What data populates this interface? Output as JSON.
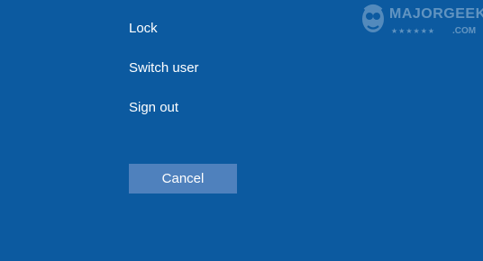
{
  "menu": {
    "items": [
      {
        "label": "Lock"
      },
      {
        "label": "Switch user"
      },
      {
        "label": "Sign out"
      }
    ]
  },
  "actions": {
    "cancel_label": "Cancel"
  },
  "watermark": {
    "brand": "MAJORGEEKS",
    "domain": ".COM",
    "stars": "★★★★★★"
  },
  "colors": {
    "background": "#0c5aa0",
    "button": "#4f81bd",
    "text": "#ffffff"
  },
  "icons": {
    "watermark_logo": "majorgeeks-logo-icon"
  }
}
